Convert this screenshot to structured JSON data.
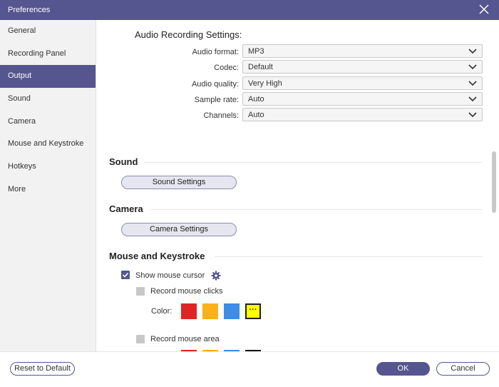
{
  "window": {
    "title": "Preferences"
  },
  "sidebar": {
    "items": [
      {
        "label": "General"
      },
      {
        "label": "Recording Panel"
      },
      {
        "label": "Output"
      },
      {
        "label": "Sound"
      },
      {
        "label": "Camera"
      },
      {
        "label": "Mouse and Keystroke"
      },
      {
        "label": "Hotkeys"
      },
      {
        "label": "More"
      }
    ],
    "active": "Output"
  },
  "audio": {
    "heading": "Audio Recording Settings:",
    "fields": [
      {
        "label": "Audio format:",
        "value": "MP3"
      },
      {
        "label": "Codec:",
        "value": "Default"
      },
      {
        "label": "Audio quality:",
        "value": "Very High"
      },
      {
        "label": "Sample rate:",
        "value": "Auto"
      },
      {
        "label": "Channels:",
        "value": "Auto"
      }
    ]
  },
  "sound": {
    "heading": "Sound",
    "button": "Sound Settings"
  },
  "camera": {
    "heading": "Camera",
    "button": "Camera Settings"
  },
  "mouse": {
    "heading": "Mouse and Keystroke",
    "show_cursor": {
      "label": "Show mouse cursor",
      "checked": true
    },
    "record_clicks": {
      "label": "Record mouse clicks",
      "checked": false
    },
    "color_label": "Color:",
    "click_colors": [
      "#e02424",
      "#fbb117",
      "#3b8de6",
      "#ffff00"
    ],
    "more_glyph": "···",
    "record_area": {
      "label": "Record mouse area",
      "checked": false
    },
    "area_colors": [
      "#e02424",
      "#fbb117",
      "#3b8de6",
      "#111111"
    ]
  },
  "footer": {
    "reset_label": "Reset to Default",
    "ok_label": "OK",
    "cancel_label": "Cancel"
  },
  "colors": {
    "accent": "#55558f",
    "titlebar": "#55558f",
    "sidebar_bg": "#f2f2f2"
  }
}
